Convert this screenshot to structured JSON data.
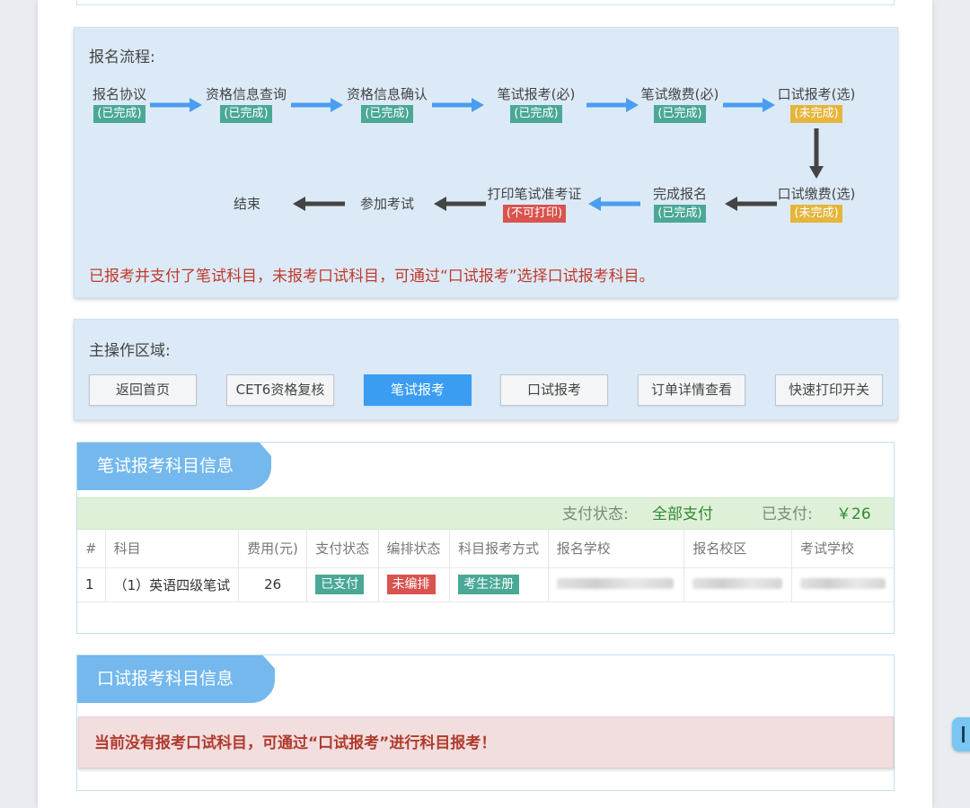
{
  "process": {
    "title": "报名流程:",
    "steps": [
      {
        "name": "报名协议",
        "status": "(已完成)"
      },
      {
        "name": "资格信息查询",
        "status": "(已完成)"
      },
      {
        "name": "资格信息确认",
        "status": "(已完成)"
      },
      {
        "name": "笔试报考(必)",
        "status": "(已完成)"
      },
      {
        "name": "笔试缴费(必)",
        "status": "(已完成)"
      },
      {
        "name": "口试报考(选)",
        "status": "(未完成)"
      },
      {
        "name": "口试缴费(选)",
        "status": "(未完成)"
      },
      {
        "name": "完成报名",
        "status": "(已完成)"
      },
      {
        "name": "打印笔试准考证",
        "status": "(不可打印)"
      },
      {
        "name": "参加考试",
        "status": ""
      },
      {
        "name": "结束",
        "status": ""
      }
    ],
    "notice": "已报考并支付了笔试科目，未报考口试科目，可通过“口试报考”选择口试报考科目。"
  },
  "operations": {
    "title": "主操作区域:",
    "buttons": [
      "返回首页",
      "CET6资格复核",
      "笔试报考",
      "口试报考",
      "订单详情查看",
      "快速打印开关"
    ],
    "active": "笔试报考"
  },
  "written": {
    "tab_title": "笔试报考科目信息",
    "pay_status_label": "支付状态:",
    "pay_status_value": "全部支付",
    "paid_label": "已支付:",
    "paid_value": "￥26",
    "columns": [
      "#",
      "科目",
      "费用(元)",
      "支付状态",
      "编排状态",
      "科目报考方式",
      "报名学校",
      "报名校区",
      "考试学校"
    ],
    "rows": [
      {
        "no": "1",
        "subject": "（1）英语四级笔试",
        "fee": "26",
        "pay_status": "已支付",
        "arrange_status": "未编排",
        "method": "考生注册"
      }
    ]
  },
  "oral": {
    "tab_title": "口试报考科目信息",
    "alert": "当前没有报考口试科目，可通过“口试报考”进行科目报考！"
  },
  "colors": {
    "accent": "#3b9df2",
    "done": "#4aa896",
    "pending": "#e5b53c",
    "error": "#d9534f",
    "panel": "#dceaf7"
  }
}
